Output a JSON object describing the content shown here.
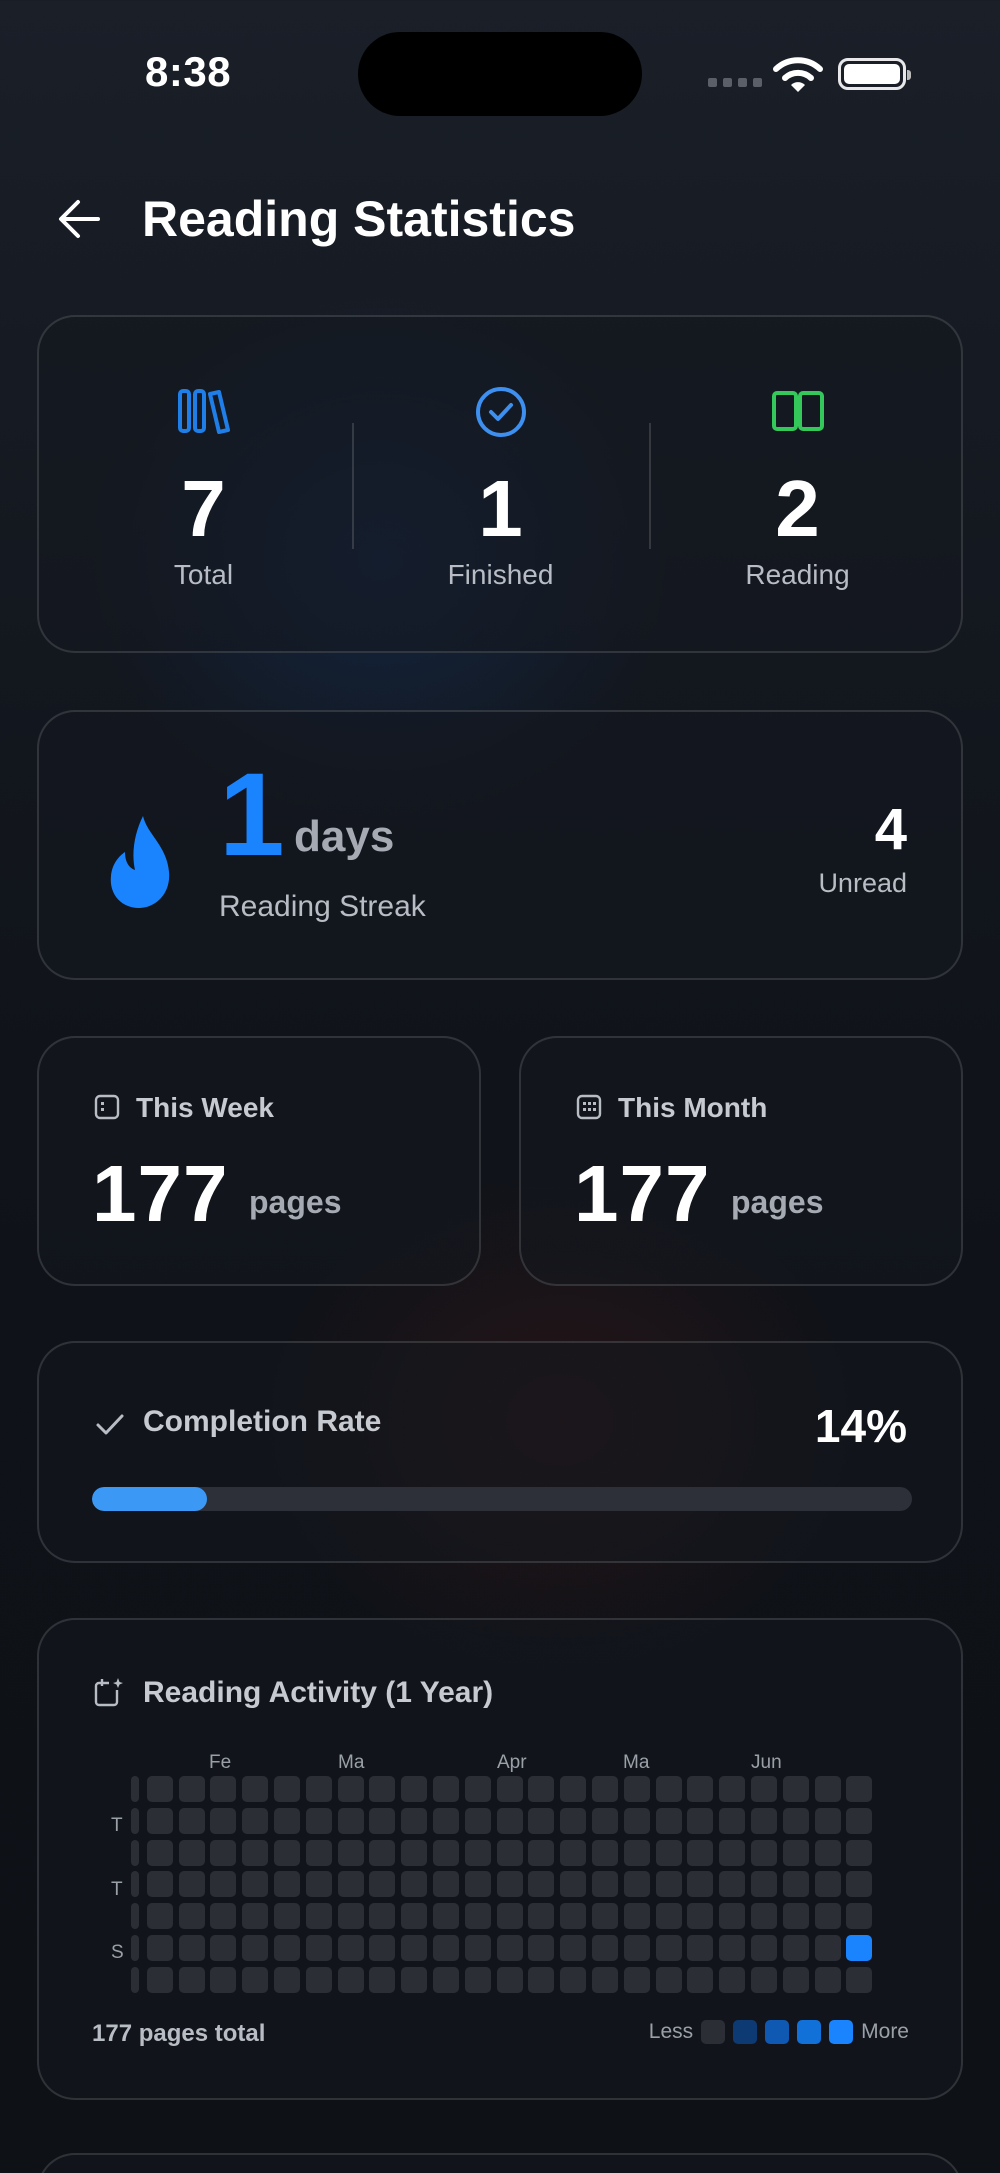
{
  "status_bar": {
    "time": "8:38"
  },
  "header": {
    "title": "Reading Statistics"
  },
  "summary": [
    {
      "value": "7",
      "label": "Total",
      "icon": "books-icon",
      "color": "#1f7ee8"
    },
    {
      "value": "1",
      "label": "Finished",
      "icon": "check-circle-icon",
      "color": "#3d8ff0"
    },
    {
      "value": "2",
      "label": "Reading",
      "icon": "open-book-icon",
      "color": "#34c759"
    }
  ],
  "streak": {
    "value": "1",
    "unit": "days",
    "label": "Reading Streak",
    "unread_value": "4",
    "unread_label": "Unread",
    "color": "#1a84ff"
  },
  "this_week": {
    "title": "This Week",
    "value": "177",
    "unit": "pages"
  },
  "this_month": {
    "title": "This Month",
    "value": "177",
    "unit": "pages"
  },
  "completion": {
    "title": "Completion Rate",
    "percent_text": "14%",
    "fraction": 0.14,
    "color": "#3b98f5"
  },
  "activity": {
    "title": "Reading Activity (1 Year)",
    "months": [
      "Fe",
      "Ma",
      "Apr",
      "Ma",
      "Jun"
    ],
    "weekday_labels": [
      "T",
      "T",
      "S"
    ],
    "total_text": "177 pages total",
    "legend_less": "Less",
    "legend_more": "More",
    "legend_colors": [
      "#2b2e35",
      "#0e3a74",
      "#0f59b3",
      "#1270d9",
      "#1a84ff"
    ],
    "weeks": 24,
    "days": 7,
    "active_cell": {
      "week": 23,
      "day": 5,
      "level": 4
    }
  }
}
